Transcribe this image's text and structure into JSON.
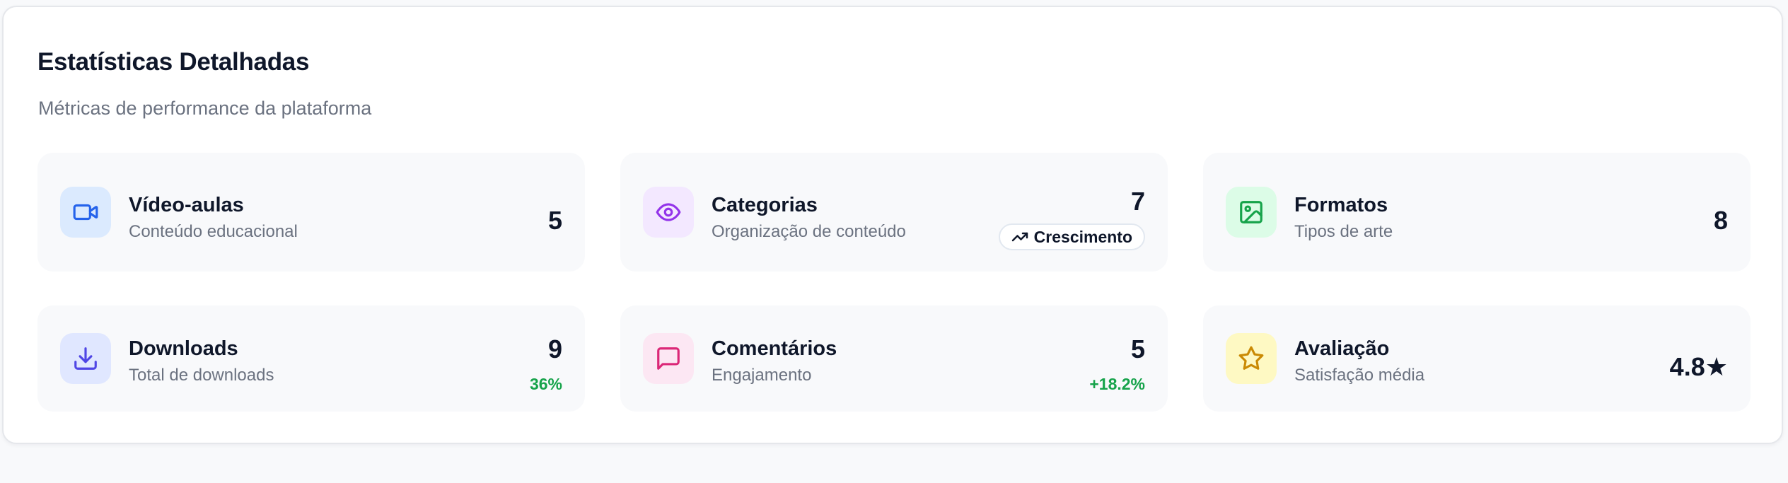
{
  "header": {
    "title": "Estatísticas Detalhadas",
    "subtitle": "Métricas de performance da plataforma"
  },
  "colors": {
    "trend_positive": "#16a34a",
    "video_icon": "#2563eb",
    "categories_icon": "#9333ea",
    "formats_icon": "#16a34a",
    "downloads_icon": "#4f46e5",
    "comments_icon": "#db2777",
    "rating_icon": "#ca8a04"
  },
  "stats": {
    "videos": {
      "title": "Vídeo-aulas",
      "subtitle": "Conteúdo educacional",
      "value": "5",
      "icon": "video-camera-icon"
    },
    "categories": {
      "title": "Categorias",
      "subtitle": "Organização de conteúdo",
      "value": "7",
      "badge": "Crescimento",
      "icon": "eye-icon"
    },
    "formats": {
      "title": "Formatos",
      "subtitle": "Tipos de arte",
      "value": "8",
      "icon": "image-icon"
    },
    "downloads": {
      "title": "Downloads",
      "subtitle": "Total de downloads",
      "value": "9",
      "trend": "36%",
      "icon": "download-icon"
    },
    "comments": {
      "title": "Comentários",
      "subtitle": "Engajamento",
      "value": "5",
      "trend": "+18.2%",
      "icon": "message-square-icon"
    },
    "rating": {
      "title": "Avaliação",
      "subtitle": "Satisfação média",
      "value": "4.8★",
      "icon": "star-icon"
    }
  }
}
